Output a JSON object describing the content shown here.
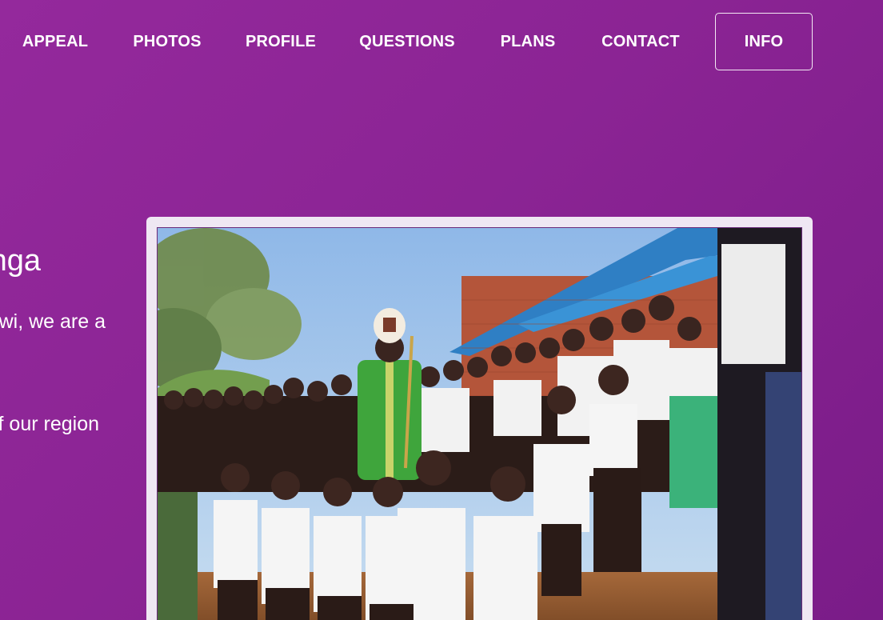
{
  "nav": {
    "items": [
      {
        "label": "APPEAL"
      },
      {
        "label": "PHOTOS"
      },
      {
        "label": "PROFILE"
      },
      {
        "label": "QUESTIONS"
      },
      {
        "label": "PLANS"
      },
      {
        "label": "CONTACT"
      }
    ],
    "cta_label": "INFO"
  },
  "hero": {
    "title_fragment": "nga",
    "line1_fragment": "wi, we are a",
    "line2_fragment": "f our region"
  },
  "photo": {
    "alt": "Bishop in green vestments with schoolchildren praying in front of a brick church"
  },
  "colors": {
    "background": "#8b2494",
    "text": "#ffffff",
    "frame": "#efe7f3"
  }
}
